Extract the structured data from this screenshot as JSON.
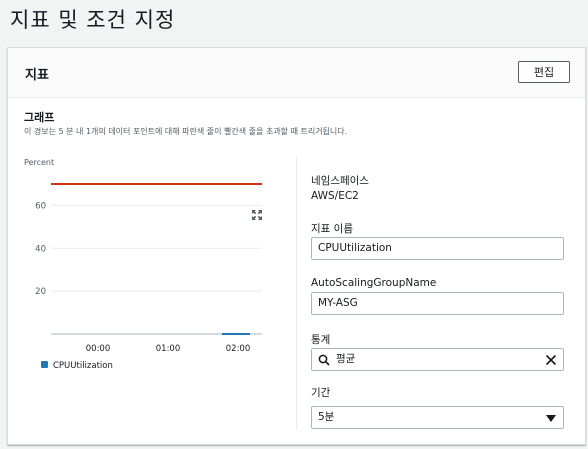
{
  "page": {
    "title": "지표 및 조건 지정"
  },
  "panel": {
    "title": "지표",
    "edit_label": "편집",
    "graph_label": "그래프",
    "graph_description": "이 경보는 5 분 내 1개의 데이터 포인트에 대해 파란색 줄이 빨간색 줄을 초과할 때 트리거됩니다."
  },
  "fields": {
    "namespace_label": "네임스페이스",
    "namespace_value": "AWS/EC2",
    "metric_name_label": "지표 이름",
    "metric_name_value": "CPUUtilization",
    "dimension_label": "AutoScalingGroupName",
    "dimension_value": "MY-ASG",
    "statistic_label": "통계",
    "statistic_value": "평균",
    "period_label": "기간",
    "period_value": "5분"
  },
  "colors": {
    "threshold": "#d13212",
    "series": "#1f77b4",
    "accent": "#0073bb"
  },
  "icons": {
    "expand": "expand-icon",
    "search": "search-icon",
    "clear": "clear-icon",
    "caret": "caret-down-icon"
  },
  "chart_data": {
    "type": "line",
    "ylabel": "Percent",
    "y_ticks": [
      20,
      40,
      60
    ],
    "ylim": [
      0,
      70
    ],
    "x_ticks": [
      "00:00",
      "01:00",
      "02:00"
    ],
    "threshold": 70,
    "series": [
      {
        "name": "CPUUtilization",
        "x": [
          "02:00"
        ],
        "values": [
          0
        ]
      }
    ],
    "legend_position": "bottom-left",
    "grid": true
  }
}
